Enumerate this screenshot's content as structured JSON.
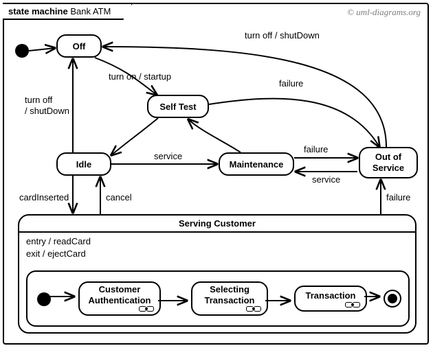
{
  "frame": {
    "keyword": "state machine",
    "name": "Bank ATM"
  },
  "credit": "© uml-diagrams.org",
  "states": {
    "off": "Off",
    "selfTest": "Self Test",
    "idle": "Idle",
    "maintenance": "Maintenance",
    "outOfService": "Out of\nService",
    "servingCustomer": {
      "title": "Serving Customer",
      "entry": "entry / readCard",
      "exit": "exit / ejectCard",
      "substates": {
        "customerAuth": "Customer\nAuthentication",
        "selectingTxn": "Selecting\nTransaction",
        "transaction": "Transaction"
      }
    }
  },
  "transitions": {
    "turnOnStartup": "turn on / startup",
    "turnOffShutDown": "turn off / shutDown",
    "turnOffShutDown2": "turn off\n/ shutDown",
    "failure": "failure",
    "service": "service",
    "cardInserted": "cardInserted",
    "cancel": "cancel"
  }
}
